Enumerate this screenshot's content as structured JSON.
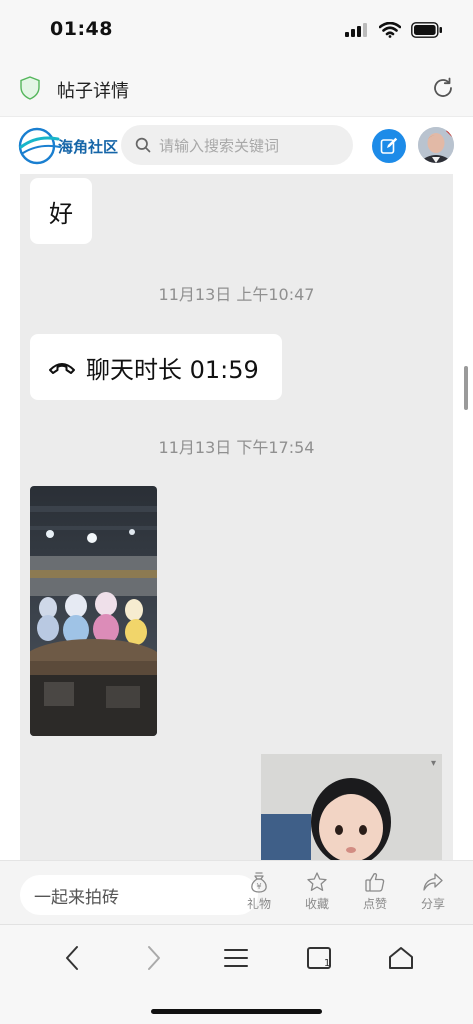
{
  "status_bar": {
    "time": "01:48"
  },
  "url_bar": {
    "title": "帖子详情"
  },
  "site_header": {
    "logo_text": "海角社区",
    "search_placeholder": "请输入搜索关键词"
  },
  "chat": {
    "message_good": "好",
    "timestamp_1": "11月13日 上午10:47",
    "call_text": "聊天时长 01:59",
    "timestamp_2": "11月13日 下午17:54"
  },
  "toolbar": {
    "comment_placeholder": "一起来拍砖",
    "gift_label": "礼物",
    "favorite_label": "收藏",
    "like_label": "点赞",
    "share_label": "分享"
  },
  "colors": {
    "accent": "#1d8be8",
    "chat_background": "#ececec",
    "bubble": "#ffffff"
  },
  "icons": [
    "shield-icon",
    "reload-icon",
    "search-icon",
    "edit-icon",
    "phone-icon",
    "gift-icon",
    "star-icon",
    "thumbs-up-icon",
    "share-icon",
    "back-icon",
    "forward-icon",
    "menu-icon",
    "tabs-icon",
    "home-icon"
  ]
}
